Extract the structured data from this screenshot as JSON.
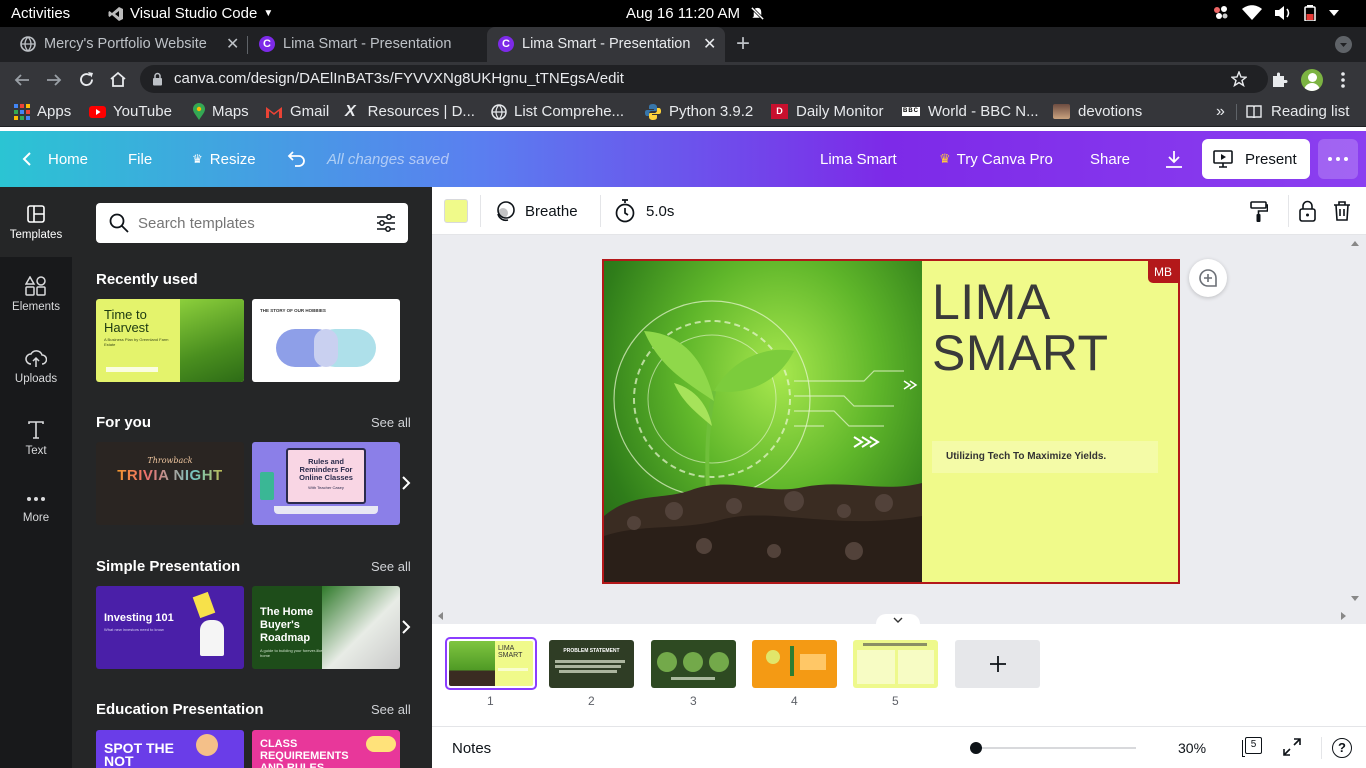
{
  "system_bar": {
    "activities": "Activities",
    "app": "Visual Studio Code",
    "datetime": "Aug 16  11:20 AM"
  },
  "tabs": [
    {
      "title": "Mercy's Portfolio Website"
    },
    {
      "title": "Lima Smart - Presentation"
    },
    {
      "title": "Lima Smart - Presentation"
    }
  ],
  "address": {
    "url": "canva.com/design/DAElInBAT3s/FYVVXNg8UKHgnu_tTNEgsA/edit"
  },
  "bookmarks": {
    "items": [
      "Apps",
      "YouTube",
      "Maps",
      "Gmail",
      "Resources | D...",
      "List Comprehe...",
      "Python 3.9.2",
      "Daily Monitor",
      "World - BBC N...",
      "devotions"
    ],
    "more": "»",
    "reading_list": "Reading list"
  },
  "canva_header": {
    "home": "Home",
    "file": "File",
    "resize": "Resize",
    "saved": "All changes saved",
    "project": "Lima Smart",
    "pro": "Try Canva Pro",
    "share": "Share",
    "present": "Present"
  },
  "rail": [
    {
      "label": "Templates"
    },
    {
      "label": "Elements"
    },
    {
      "label": "Uploads"
    },
    {
      "label": "Text"
    },
    {
      "label": "More"
    }
  ],
  "panel": {
    "search_placeholder": "Search templates",
    "sections": [
      {
        "title": "Recently used",
        "see_all": ""
      },
      {
        "title": "For you",
        "see_all": "See all"
      },
      {
        "title": "Simple Presentation",
        "see_all": "See all"
      },
      {
        "title": "Education Presentation",
        "see_all": "See all"
      }
    ],
    "thumbs": {
      "harvest_title": "Time to Harvest",
      "harvest_sub": "A Business Plan by Greenland Farm Estate",
      "hobbies_title": "THE STORY OF OUR HOBBIES",
      "trivia_top": "Throwback",
      "trivia_main": "TRIVIA NIGHT",
      "rules_title": "Rules and Reminders For Online Classes",
      "rules_sub": "With Teacher Casey",
      "investing": "Investing 101",
      "investing_sub": "What new investors need to know",
      "roadmap": "The Home Buyer's Roadmap",
      "roadmap_sub": "A guide to building your forever-like home",
      "spot": "SPOT THE NOT",
      "class_req": "CLASS REQUIREMENTS AND RULES"
    }
  },
  "toolbar": {
    "color": "#f0fa8a",
    "animation": "Breathe",
    "duration": "5.0s"
  },
  "slide": {
    "title_line1": "LIMA",
    "title_line2": "SMART",
    "subtitle": "Utilizing Tech To Maximize Yields.",
    "badge": "MB",
    "bg_color": "#f0fa8a"
  },
  "pages": [
    {
      "number": "1",
      "title": "LIMA SMART"
    },
    {
      "number": "2",
      "title": "PROBLEM STATEMENT"
    },
    {
      "number": "3",
      "title": ""
    },
    {
      "number": "4",
      "title": ""
    },
    {
      "number": "5",
      "title": ""
    }
  ],
  "notes": {
    "label": "Notes",
    "zoom": "30%",
    "zoom_level": 0,
    "page_count": "5"
  }
}
